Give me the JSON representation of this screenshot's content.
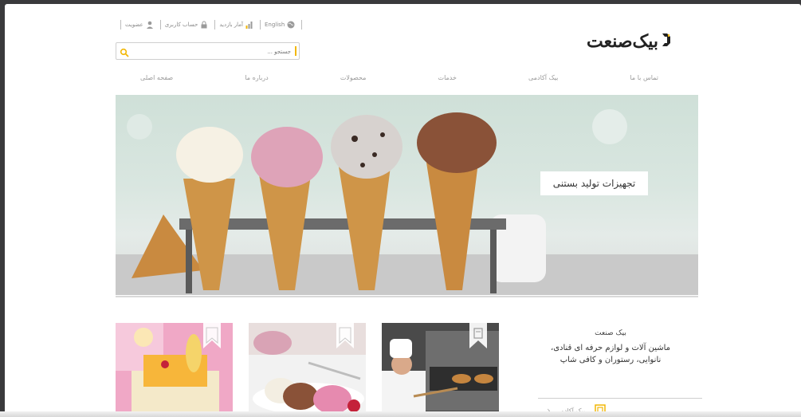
{
  "topbar": {
    "membership": "عضویت",
    "account": "حساب کاربری",
    "stats": "آمار بازدید",
    "language": "English",
    "icons": [
      "user-icon",
      "lock-icon",
      "bar-chart-icon",
      "globe-icon"
    ]
  },
  "logo": {
    "text": "بیک‌صنعت"
  },
  "search": {
    "placeholder": "جستجو ..."
  },
  "nav": {
    "items": [
      "صفحه اصلی",
      "درباره ما",
      "محصولات",
      "خدمات",
      "بیک آکادمی",
      "تماس با ما"
    ]
  },
  "hero": {
    "caption": "تجهیزات تولید بستنی"
  },
  "intro": {
    "title": "بیک صنعت",
    "line1": "ماشین آلات و لوازم حرفه ای قنادی،",
    "line2": "نانوایی، رستوران و کافی شاپ"
  },
  "academy": {
    "label": "بیک آکادمی"
  },
  "colors": {
    "accent": "#f2b705",
    "nav_text": "#9a9a9a"
  }
}
